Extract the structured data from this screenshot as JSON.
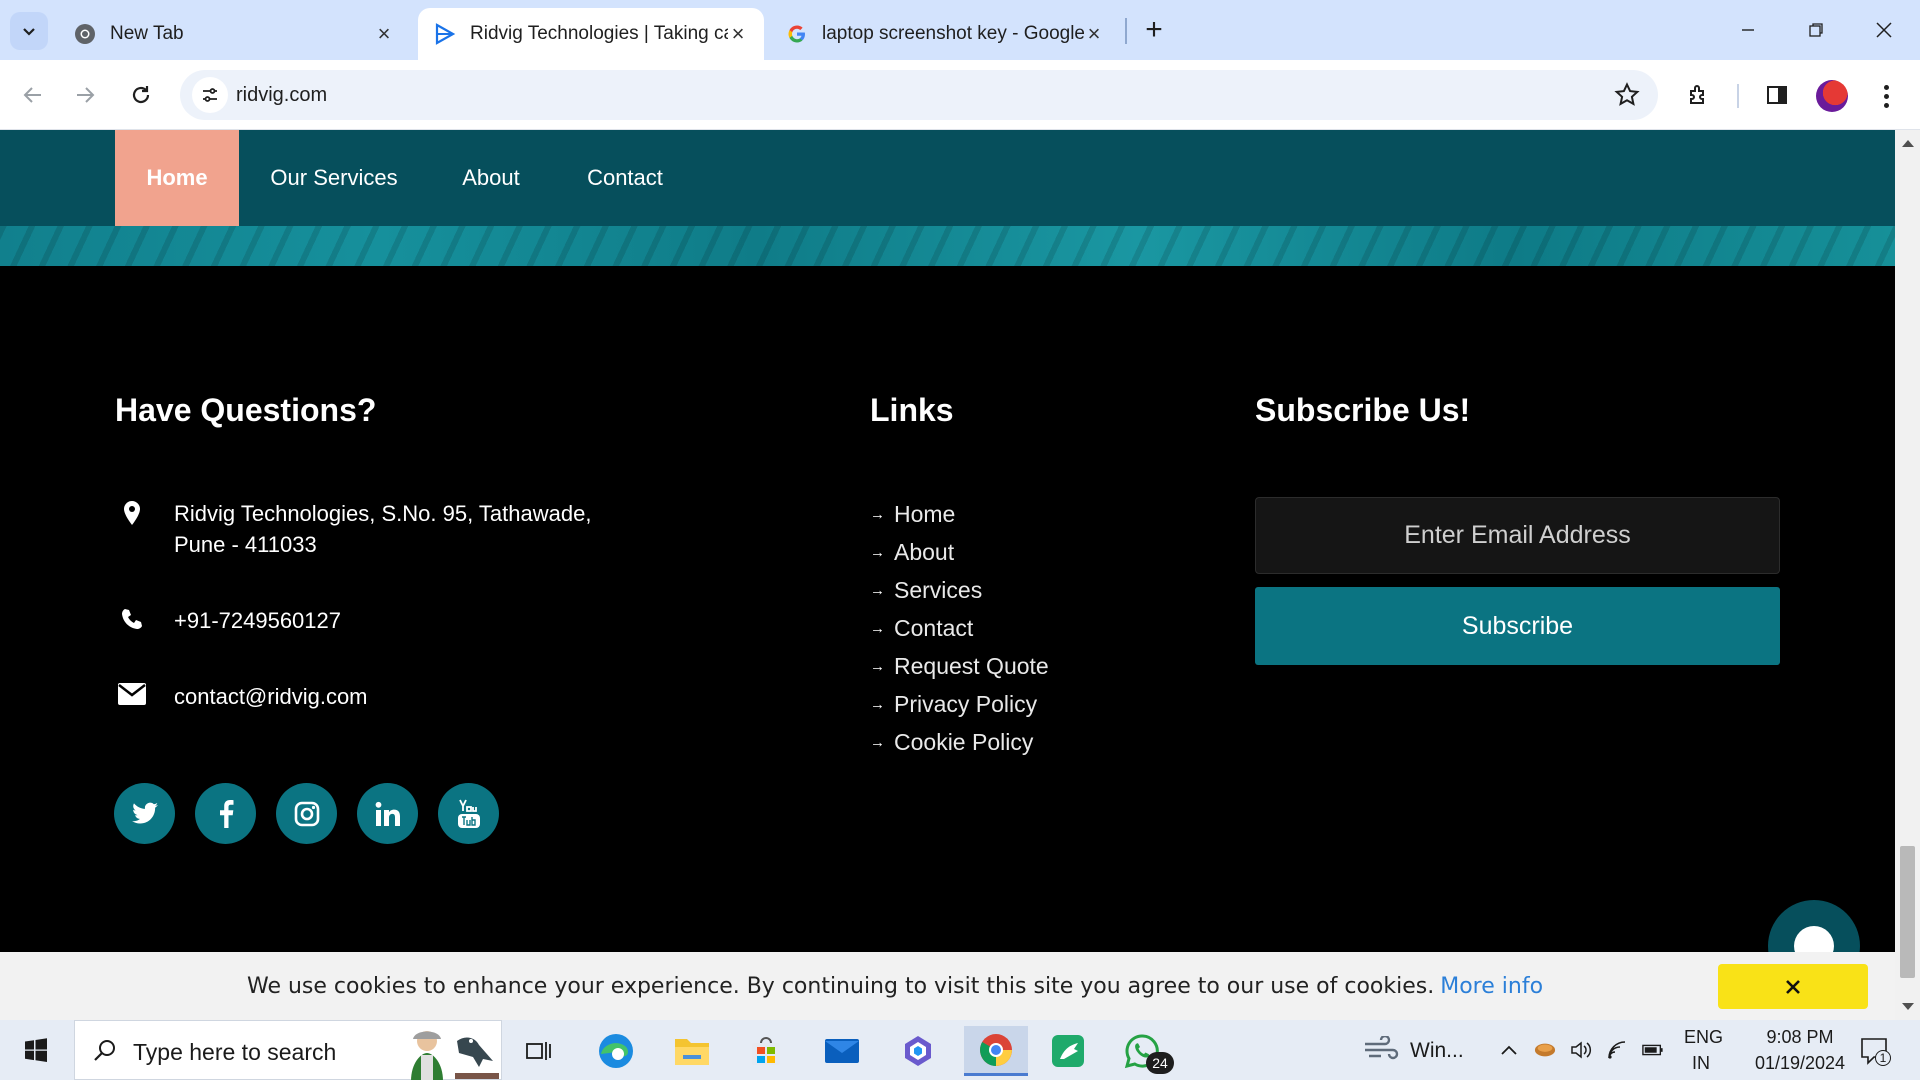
{
  "browser": {
    "tabs": [
      {
        "title": "New Tab",
        "active": false
      },
      {
        "title": "Ridvig Technologies | Taking care",
        "active": true
      },
      {
        "title": "laptop screenshot key - Google",
        "active": false
      }
    ],
    "url": "ridvig.com"
  },
  "site": {
    "nav": [
      "Home",
      "Our Services",
      "About",
      "Contact"
    ],
    "active_nav": "Home",
    "footer": {
      "questions_heading": "Have Questions?",
      "address": "Ridvig Technologies, S.No. 95, Tathawade, Pune - 411033",
      "phone": "+91-7249560127",
      "email": "contact@ridvig.com",
      "socials": [
        "twitter",
        "facebook",
        "instagram",
        "linkedin",
        "youtube"
      ],
      "links_heading": "Links",
      "links": [
        "Home",
        "About",
        "Services",
        "Contact",
        "Request Quote",
        "Privacy Policy",
        "Cookie Policy"
      ],
      "subscribe_heading": "Subscribe Us!",
      "email_placeholder": "Enter Email Address",
      "subscribe_button": "Subscribe"
    },
    "cookie": {
      "message": "We use cookies to enhance your experience. By continuing to visit this site you agree to our use of cookies.",
      "more_info": "More info"
    }
  },
  "colors": {
    "nav_bg": "#064f5c",
    "nav_active": "#f1a38e",
    "accent_teal": "#0b7482",
    "cookie_close": "#f9e217"
  },
  "taskbar": {
    "search_placeholder": "Type here to search",
    "whatsapp_badge": "24",
    "weather_label": "Win...",
    "language": "ENG",
    "region": "IN",
    "time": "9:08 PM",
    "date": "01/19/2024",
    "notifications": "1"
  }
}
